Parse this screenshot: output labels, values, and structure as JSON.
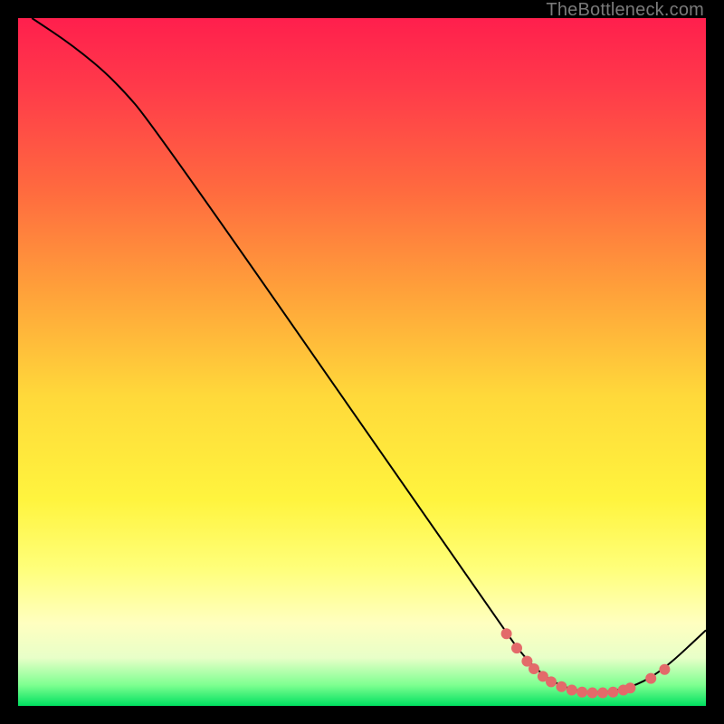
{
  "watermark": "TheBottleneck.com",
  "chart_data": {
    "type": "line",
    "title": "",
    "xlabel": "",
    "ylabel": "",
    "xlim": [
      0,
      100
    ],
    "ylim": [
      0,
      100
    ],
    "curve": [
      {
        "x": 2,
        "y": 100
      },
      {
        "x": 8,
        "y": 96
      },
      {
        "x": 14,
        "y": 91
      },
      {
        "x": 20,
        "y": 84
      },
      {
        "x": 70,
        "y": 12
      },
      {
        "x": 74,
        "y": 6.5
      },
      {
        "x": 78,
        "y": 3.2
      },
      {
        "x": 82,
        "y": 2.0
      },
      {
        "x": 86,
        "y": 2.0
      },
      {
        "x": 90,
        "y": 3.0
      },
      {
        "x": 94,
        "y": 5.4
      },
      {
        "x": 100,
        "y": 11
      }
    ],
    "highlight_dots": [
      {
        "x": 71,
        "y": 10.5
      },
      {
        "x": 72.5,
        "y": 8.4
      },
      {
        "x": 74,
        "y": 6.5
      },
      {
        "x": 75,
        "y": 5.4
      },
      {
        "x": 76.3,
        "y": 4.3
      },
      {
        "x": 77.5,
        "y": 3.5
      },
      {
        "x": 79,
        "y": 2.8
      },
      {
        "x": 80.5,
        "y": 2.3
      },
      {
        "x": 82,
        "y": 2.0
      },
      {
        "x": 83.5,
        "y": 1.9
      },
      {
        "x": 85,
        "y": 1.9
      },
      {
        "x": 86.5,
        "y": 2.0
      },
      {
        "x": 88,
        "y": 2.3
      },
      {
        "x": 89,
        "y": 2.6
      },
      {
        "x": 92,
        "y": 4.0
      },
      {
        "x": 94,
        "y": 5.3
      }
    ],
    "gradient_zones_note": "background encodes score: red=bad at top, green=good at bottom"
  }
}
